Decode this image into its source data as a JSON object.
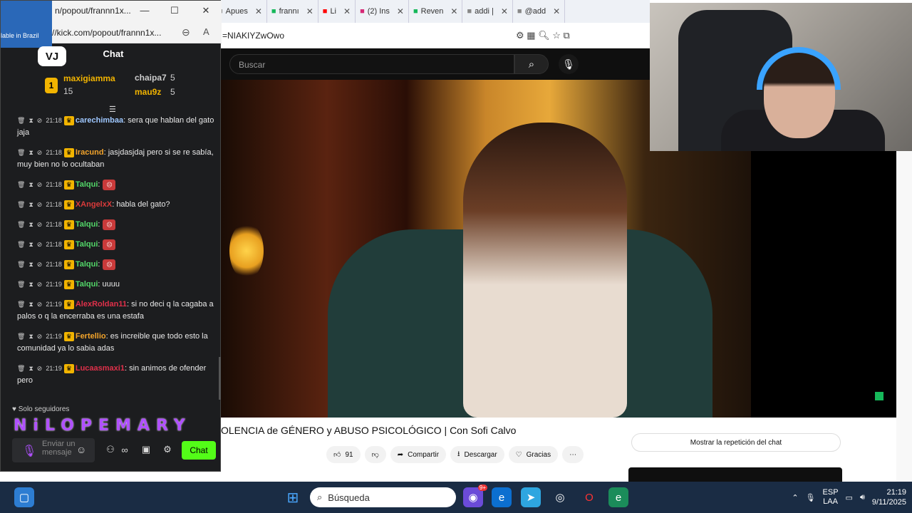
{
  "browser": {
    "tabs": [
      {
        "label": "Apues",
        "icon": "tab-icon"
      },
      {
        "label": "frannı",
        "icon": "kick-icon"
      },
      {
        "label": "Li",
        "icon": "youtube-icon"
      },
      {
        "label": "(2) Ins",
        "icon": "instagram-icon"
      },
      {
        "label": "Reven",
        "icon": "kick-icon"
      },
      {
        "label": "addi |",
        "icon": "tab-icon"
      },
      {
        "label": "@add",
        "icon": "tab-icon"
      }
    ],
    "address": "=NIAKIYZwOwo",
    "search_placeholder": "Buscar"
  },
  "popout": {
    "title": "n/popout/frannn1x...",
    "url": "//kick.com/popout/frannn1x...",
    "notification": "lable in Brazil",
    "chat_title": "Chat",
    "logo": "VJ",
    "gifters": [
      {
        "rank": "1",
        "name": "maxigiamma",
        "count": "15"
      },
      {
        "name": "chaipa7",
        "count": "5"
      },
      {
        "name": "mau9z",
        "count": "5"
      }
    ],
    "messages": [
      {
        "time": "21:18",
        "user": "carechimbaa",
        "color": "#9ec7ff",
        "text": ": sera que hablan del gato jaja"
      },
      {
        "time": "21:18",
        "user": "Iracund",
        "color": "#f3a42b",
        "text": ": jasjdasjdaj pero si se re sabía, muy bien no lo ocultaban"
      },
      {
        "time": "21:18",
        "user": "Talqui",
        "color": "#53d769",
        "text": ":"
      },
      {
        "time": "21:18",
        "user": "XAngelxX",
        "color": "#d93a3a",
        "text": ": habla del gato?"
      },
      {
        "time": "21:18",
        "user": "Talqui",
        "color": "#53d769",
        "text": ":"
      },
      {
        "time": "21:18",
        "user": "Talqui",
        "color": "#53d769",
        "text": ":"
      },
      {
        "time": "21:18",
        "user": "Talqui",
        "color": "#53d769",
        "text": ":"
      },
      {
        "time": "21:19",
        "user": "Talqui",
        "color": "#53d769",
        "text": ": uuuu"
      },
      {
        "time": "21:19",
        "user": "AlexRoldan11",
        "color": "#e0304a",
        "text": ": si no deci q la cagaba a palos o q la encerraba es una estafa"
      },
      {
        "time": "21:19",
        "user": "Fertellio",
        "color": "#f3a42b",
        "text": ": es increible que todo esto la comunidad ya lo sabia adas"
      },
      {
        "time": "21:19",
        "user": "Lucaasmaxi1",
        "color": "#e0304a",
        "text": ": sin animos de ofender pero"
      }
    ],
    "followers_only": "Solo seguidores",
    "banner": "NiLOPEMARY",
    "input_placeholder": "Enviar un mensaje",
    "send_label": "Chat"
  },
  "video": {
    "title": "OLENCIA de GÉNERO y ABUSO PSICOLÓGICO | Con Sofi Calvo",
    "likes": "91",
    "share": "Compartir",
    "download": "Descargar",
    "thanks": "Gracias",
    "replay_chat": "Mostrar la repetición del chat"
  },
  "taskbar": {
    "search": "Búsqueda",
    "lang": "ESP",
    "lang2": "LAA",
    "time": "21:19",
    "date": "9/11/2025",
    "badge": "9+"
  },
  "colors": {
    "kick_green": "#53fc18",
    "taskbar": "#1a2c44",
    "chat_bg": "#1c1d1f"
  }
}
